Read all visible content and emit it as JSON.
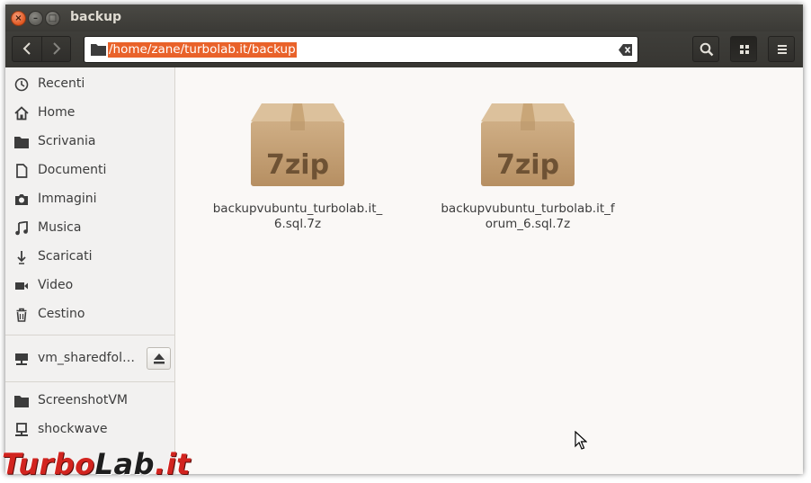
{
  "window": {
    "title": "backup"
  },
  "toolbar": {
    "path": "/home/zane/turbolab.it/backup"
  },
  "sidebar": {
    "places": [
      {
        "label": "Recenti",
        "icon": "recent-icon"
      },
      {
        "label": "Home",
        "icon": "home-icon"
      },
      {
        "label": "Scrivania",
        "icon": "desktop-folder-icon"
      },
      {
        "label": "Documenti",
        "icon": "document-icon"
      },
      {
        "label": "Immagini",
        "icon": "camera-icon"
      },
      {
        "label": "Musica",
        "icon": "music-icon"
      },
      {
        "label": "Scaricati",
        "icon": "download-icon"
      },
      {
        "label": "Video",
        "icon": "video-icon"
      },
      {
        "label": "Cestino",
        "icon": "trash-icon"
      }
    ],
    "devices": [
      {
        "label": "vm_sharedfol…",
        "icon": "network-drive-icon"
      }
    ],
    "bookmarks": [
      {
        "label": "ScreenshotVM",
        "icon": "folder-icon"
      },
      {
        "label": "shockwave",
        "icon": "network-computer-icon"
      }
    ]
  },
  "files": [
    {
      "name": "backupvubuntu_turbolab.it_6.sql.7z",
      "icon_label": "7zip"
    },
    {
      "name": "backupvubuntu_turbolab.it_forum_6.sql.7z",
      "icon_label": "7zip"
    }
  ],
  "watermark": {
    "part1": "Turbo",
    "part2": "Lab",
    "part3": ".it"
  },
  "colors": {
    "accent": "#e9622a",
    "titlebar": "#3b3a36",
    "sidebar": "#f2f1f0",
    "content": "#faf8f6",
    "watermark_red": "#d2241f"
  }
}
